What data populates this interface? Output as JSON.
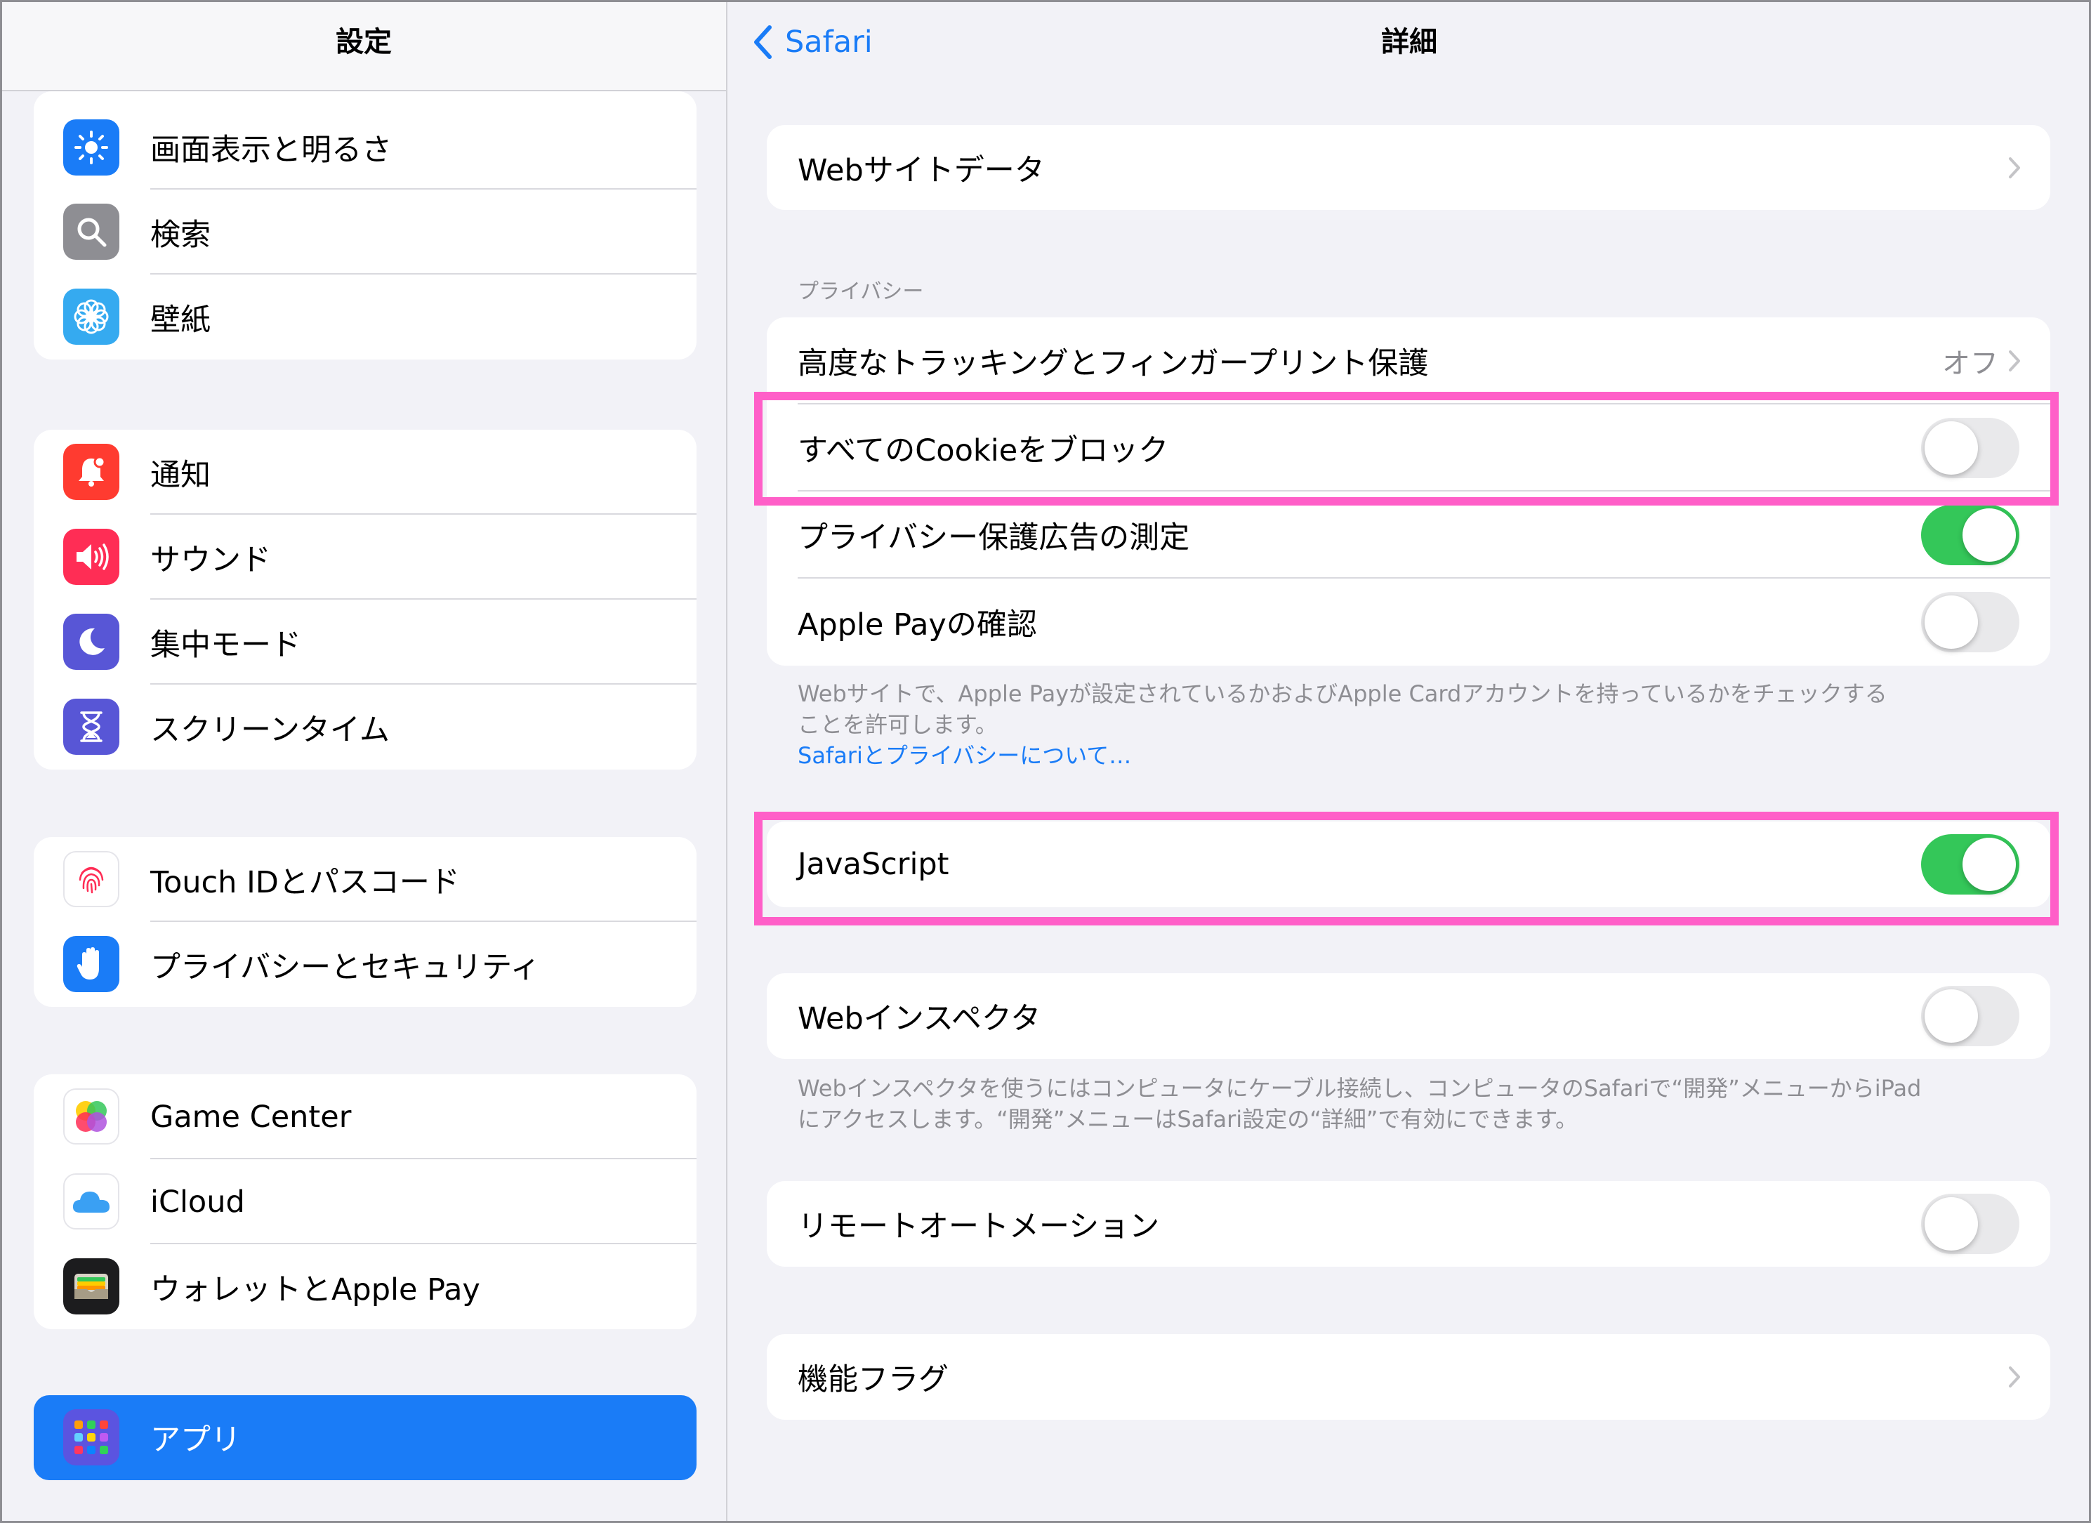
{
  "sidebar": {
    "title": "設定",
    "groups": [
      [
        {
          "label": "画面表示と明るさ",
          "icon": "sun-icon",
          "color": "#1a7cf7"
        },
        {
          "label": "検索",
          "icon": "search-icon",
          "color": "#8e8e93"
        },
        {
          "label": "壁紙",
          "icon": "flower-icon",
          "color": "#35aaf0"
        }
      ],
      [
        {
          "label": "通知",
          "icon": "bell-icon",
          "color": "#ff3b30"
        },
        {
          "label": "サウンド",
          "icon": "speaker-icon",
          "color": "#ff2d55"
        },
        {
          "label": "集中モード",
          "icon": "moon-icon",
          "color": "#5856d6"
        },
        {
          "label": "スクリーンタイム",
          "icon": "hourglass-icon",
          "color": "#5856d6"
        }
      ],
      [
        {
          "label": "Touch IDとパスコード",
          "icon": "fingerprint-icon",
          "color": "#ffffff"
        },
        {
          "label": "プライバシーとセキュリティ",
          "icon": "hand-icon",
          "color": "#1a7cf7"
        }
      ],
      [
        {
          "label": "Game Center",
          "icon": "game-center-icon",
          "color": "#ffffff"
        },
        {
          "label": "iCloud",
          "icon": "cloud-icon",
          "color": "#ffffff"
        },
        {
          "label": "ウォレットとApple Pay",
          "icon": "wallet-icon",
          "color": "#1c1c1e"
        }
      ]
    ],
    "selected": {
      "label": "アプリ",
      "icon": "apps-grid-icon"
    }
  },
  "detail": {
    "back_label": "Safari",
    "title": "詳細",
    "website_data": "Webサイトデータ",
    "privacy_header": "プライバシー",
    "tracking_label": "高度なトラッキングとフィンガープリント保護",
    "tracking_value": "オフ",
    "block_cookies": "すべてのCookieをブロック",
    "block_cookies_on": false,
    "ad_measurement": "プライバシー保護広告の測定",
    "ad_measurement_on": true,
    "apple_pay_check": "Apple Payの確認",
    "apple_pay_check_on": false,
    "privacy_footer_1": "Webサイトで、Apple Payが設定されているかおよびApple Cardアカウントを持っているかをチェックする",
    "privacy_footer_2": "ことを許可します。",
    "privacy_link": "Safariとプライバシーについて…",
    "javascript": "JavaScript",
    "javascript_on": true,
    "web_inspector": "Webインスペクタ",
    "web_inspector_on": false,
    "inspector_footer_1": "Webインスペクタを使うにはコンピュータにケーブル接続し、コンピュータのSafariで“開発”メニューからiPad",
    "inspector_footer_2": "にアクセスします。“開発”メニューはSafari設定の“詳細”で有効にできます。",
    "remote_automation": "リモートオートメーション",
    "remote_automation_on": false,
    "feature_flags": "機能フラグ"
  },
  "colors": {
    "accent": "#1a7cf7",
    "toggle_on": "#34c759",
    "highlight": "#ff5fc8"
  }
}
